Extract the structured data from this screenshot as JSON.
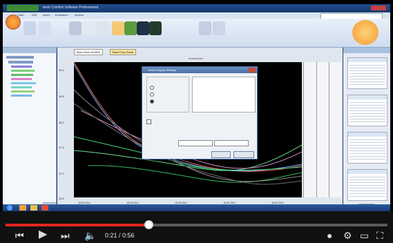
{
  "window": {
    "title": "testo Comfort Software Professional"
  },
  "ribbon_tabs": [
    "Start",
    "Edit",
    "Insert",
    "Evaluation",
    "Archive"
  ],
  "chart_panel": {
    "header": "Ansicht plot",
    "tabs": [
      "Base Main Schiebe",
      "Base Flow Kanal"
    ]
  },
  "dialog": {
    "title": "Select Display Settings"
  },
  "player": {
    "current_time": "0:21",
    "duration": "0:56",
    "progress": 0.375
  },
  "colors": {
    "accent": "#e52521",
    "plot_bg": "#000000",
    "ribbon": "#dce6f4"
  }
}
